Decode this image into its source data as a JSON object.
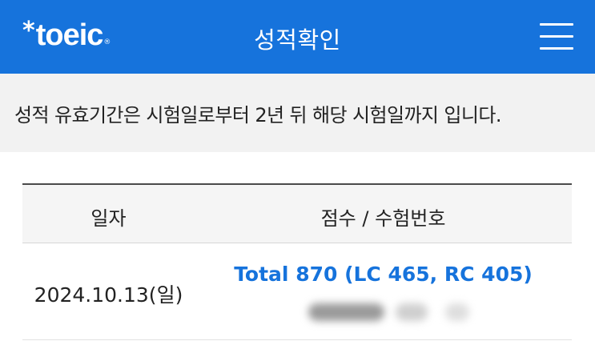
{
  "header": {
    "logo_text": "toeic",
    "logo_star": "*",
    "logo_registered": "®",
    "title": "성적확인",
    "menu_icon": "hamburger-menu-icon"
  },
  "notice": {
    "text": "성적 유효기간은 시험일로부터 2년 뒤 해당 시험일까지 입니다."
  },
  "table": {
    "columns": [
      "일자",
      "점수 / 수험번호"
    ],
    "rows": [
      {
        "date": "2024.10.13(일)",
        "score": "Total 870 (LC 465, RC 405)",
        "registration_number": ""
      }
    ]
  },
  "colors": {
    "brand_blue": "#1673dc",
    "notice_bg": "#f2f2f2",
    "score_text": "#1673dc"
  }
}
